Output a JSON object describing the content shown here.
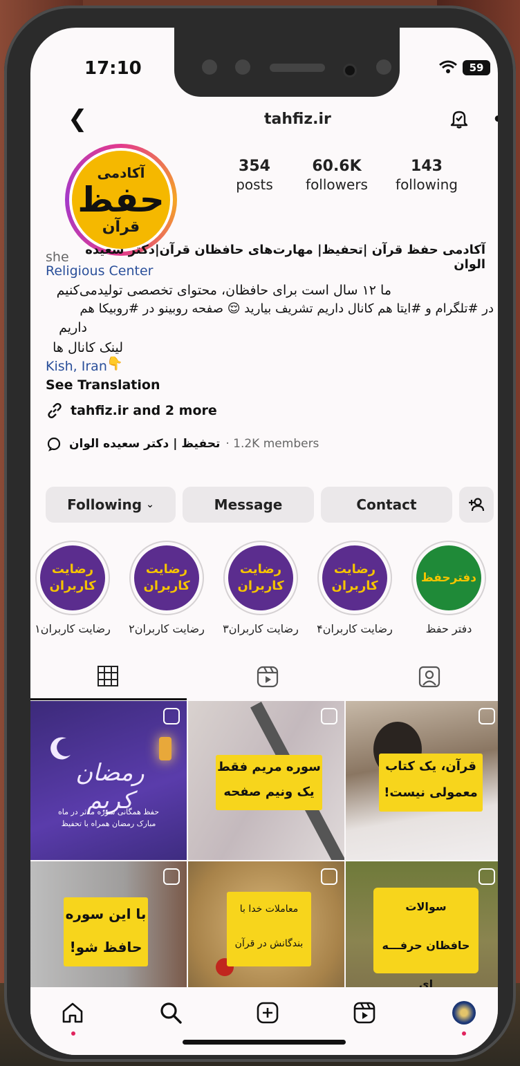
{
  "status": {
    "time": "17:10",
    "battery": "59"
  },
  "header": {
    "username": "tahfiz.ir"
  },
  "profile": {
    "avatar_text": [
      "آکادمی",
      "حفظ",
      "قرآن"
    ],
    "stats": [
      {
        "value": "354",
        "label": "posts"
      },
      {
        "value": "60.6K",
        "label": "followers"
      },
      {
        "value": "143",
        "label": "following"
      }
    ],
    "bio_name": "آکادمی حفظ قرآن |تحفیظ| مهارت‌های حافظان قرآن|دکتر سعیده الوان",
    "pronoun": "she",
    "category": "Religious Center",
    "bio_line1": "ما ۱۲ سال است برای حافظان، محتوای تخصصی تولیدمی‌کنیم",
    "bio_line2": "در #تلگرام و #ایتا هم کانال داریم تشریف بیارید 😌 صفحه روبینو در #روبیکا هم",
    "bio_line3": "داریم",
    "bio_line4": "لینک کانال ها 👇",
    "location": "Kish, Iran",
    "see_translation": "See Translation",
    "links": "tahfiz.ir and 2 more",
    "channel_name": "تحفیظ | دکتر سعیده الوان",
    "channel_members": "· 1.2K members"
  },
  "actions": {
    "following": "Following",
    "message": "Message",
    "contact": "Contact"
  },
  "highlights": [
    {
      "inner1": "رضایت",
      "inner2": "کاربران",
      "label": "رضایت کاربران۱"
    },
    {
      "inner1": "رضایت",
      "inner2": "کاربران",
      "label": "رضایت کاربران۲"
    },
    {
      "inner1": "رضایت",
      "inner2": "کاربران",
      "label": "رضایت کاربران۳"
    },
    {
      "inner1": "رضایت",
      "inner2": "کاربران",
      "label": "رضایت کاربران۴"
    },
    {
      "inner1": "دفترحفظ",
      "label": "دفتر حفظ"
    }
  ],
  "posts": {
    "p1_text": "حفظ همگانی سوره مدثر در ماه مبارک رمضان همراه با تحفیظ",
    "p2_line1": "سوره مریم فقط",
    "p2_line2": "یک ونیم صفحه",
    "p3_line1": "قرآن، یک کتاب",
    "p3_line2": "معمولی نیست!",
    "p4_line1": "با این سوره",
    "p4_line2": "حافظ شو!",
    "p5_line1": "معاملات خدا با",
    "p5_line2": "بندگانش در قرآن",
    "p6_line1": "سوالات",
    "p6_line2": "حافظان حرفـــه ای"
  },
  "colors": {
    "link": "#2a4f9a",
    "highlight_bg": "#5b2d8e",
    "highlight_text": "#f5c400",
    "brand_yellow": "#f5b800"
  },
  "icons": [
    "back-icon",
    "bell-icon",
    "more-icon",
    "link-icon",
    "threads-icon",
    "add-person-icon",
    "grid-icon",
    "reels-icon",
    "tagged-icon",
    "home-icon",
    "search-icon",
    "create-icon",
    "reels-nav-icon",
    "profile-avatar-icon"
  ]
}
